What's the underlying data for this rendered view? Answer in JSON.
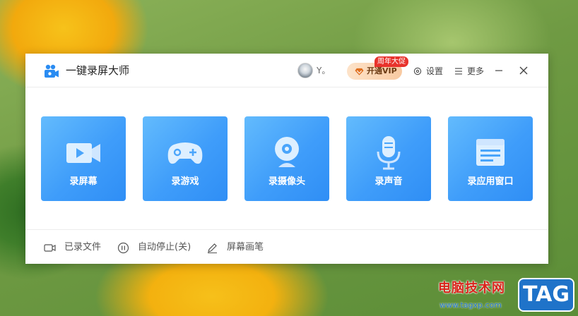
{
  "app": {
    "title": "一键录屏大师",
    "logo_icon": "video-camera-icon"
  },
  "header": {
    "user_name": "Y。",
    "vip_label": "开通VIP",
    "promo_badge": "周年大促",
    "settings_label": "设置",
    "more_label": "更多",
    "minimize_icon": "minimize-icon",
    "close_icon": "close-icon"
  },
  "cards": [
    {
      "label": "录屏幕",
      "icon": "video-camera-icon"
    },
    {
      "label": "录游戏",
      "icon": "gamepad-icon"
    },
    {
      "label": "录摄像头",
      "icon": "webcam-icon"
    },
    {
      "label": "录声音",
      "icon": "microphone-icon"
    },
    {
      "label": "录应用窗口",
      "icon": "app-window-icon"
    }
  ],
  "footer": {
    "recorded_files": "已录文件",
    "auto_stop": "自动停止(关)",
    "screen_pen": "屏幕画笔"
  },
  "colors": {
    "card_gradient_start": "#63bbfd",
    "card_gradient_end": "#2f8ef5",
    "vip_background": "#fde3c9",
    "promo_badge": "#e8332c"
  },
  "watermark": {
    "text": "电脑技术网",
    "url": "www.tagxp.com",
    "tag": "TAG"
  }
}
